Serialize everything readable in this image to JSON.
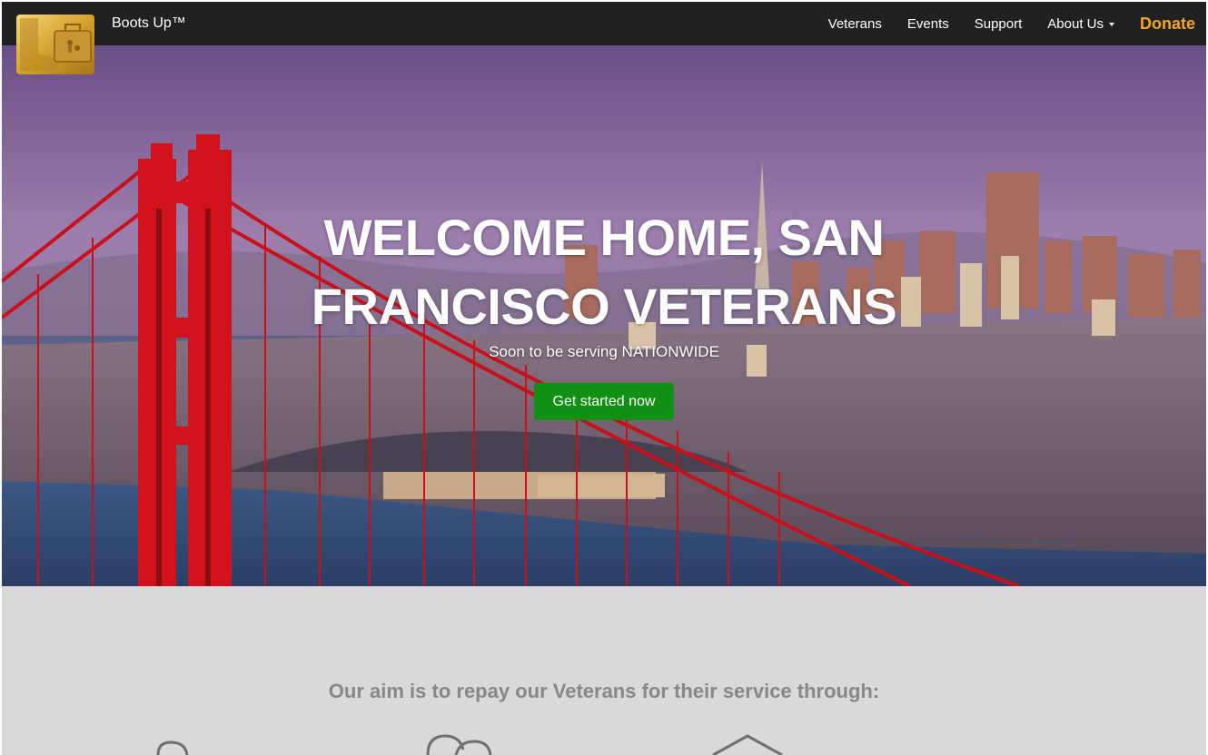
{
  "nav": {
    "brand": "Boots Up™",
    "links": [
      "Veterans",
      "Events",
      "Support",
      "About Us"
    ],
    "donate": "Donate",
    "logo_icon": "boot-and-briefcase-logo"
  },
  "hero": {
    "title_line1": "WELCOME HOME, SAN",
    "title_line2": "FRANCISCO VETERANS",
    "subtitle": "Soon to be serving NATIONWIDE",
    "cta": "Get started now",
    "background": "golden-gate-bridge-and-san-francisco-skyline-photo"
  },
  "aim": {
    "heading": "Our aim is to repay our Veterans for their service through:",
    "icons": [
      "person-head-icon",
      "speech-bubbles-icon",
      "house-icon"
    ]
  },
  "colors": {
    "navbar": "#212121",
    "donate": "#f5a623",
    "cta": "#119113",
    "section_bg": "#d9d9d9",
    "heading_text": "#878787",
    "bridge": "#d0121a"
  }
}
